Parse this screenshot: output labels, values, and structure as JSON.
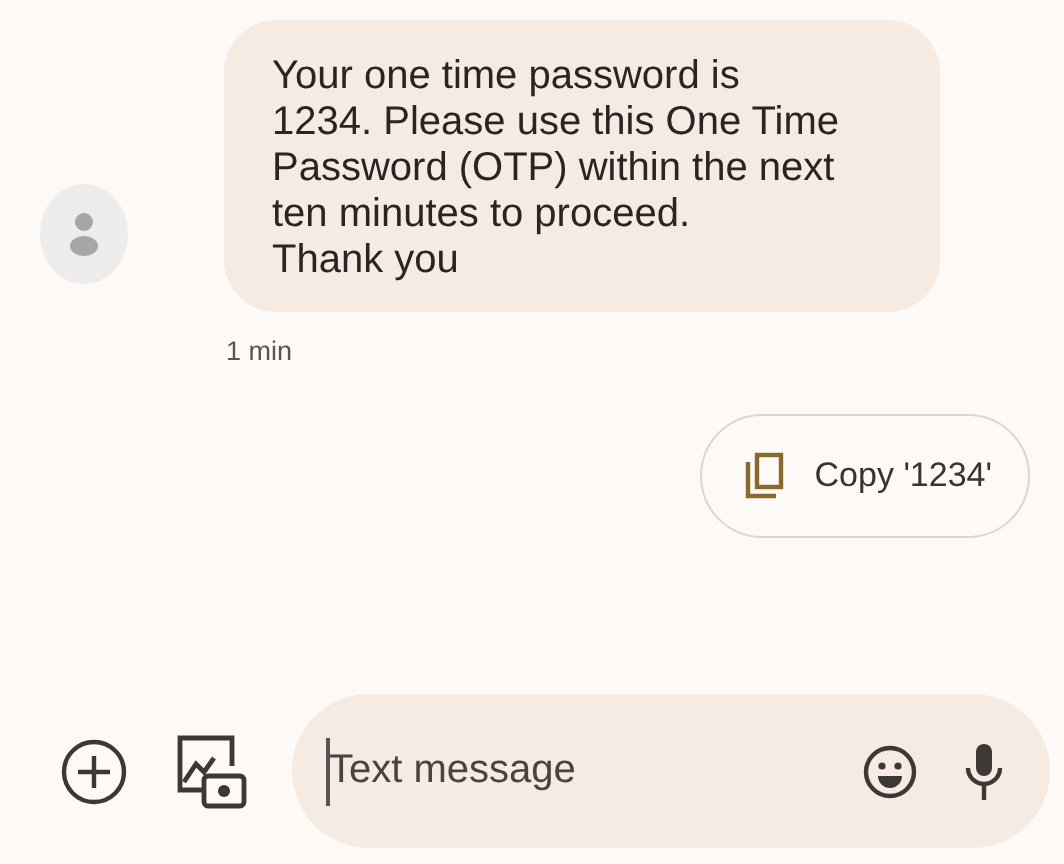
{
  "message": {
    "text": "Your one time password is\n1234. Please use this One Time\nPassword (OTP) within the next\nten minutes to proceed.\nThank you",
    "time": "1 min"
  },
  "suggestion": {
    "label": "Copy '1234'"
  },
  "compose": {
    "placeholder": "Text message"
  }
}
